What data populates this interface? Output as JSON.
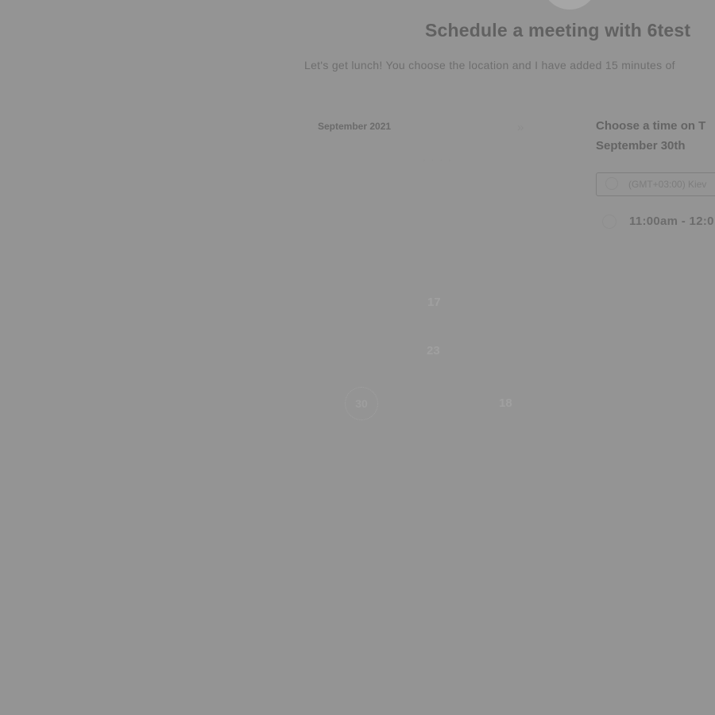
{
  "header": {
    "title": "Schedule a meeting with 6test",
    "subtitle": "Let's get lunch! You choose the location and I have added 15 minutes of"
  },
  "calendar": {
    "month_label": "September 2021",
    "next_icon": "»",
    "weekday_hint": "· · · ·",
    "days": [
      "17",
      "23",
      "18"
    ],
    "selected_day": "30"
  },
  "times": {
    "heading": "Choose a time on T\nSeptember 30th",
    "timezone": "(GMT+03:00) Kiev",
    "slots": [
      "11:00am - 12:0"
    ]
  }
}
